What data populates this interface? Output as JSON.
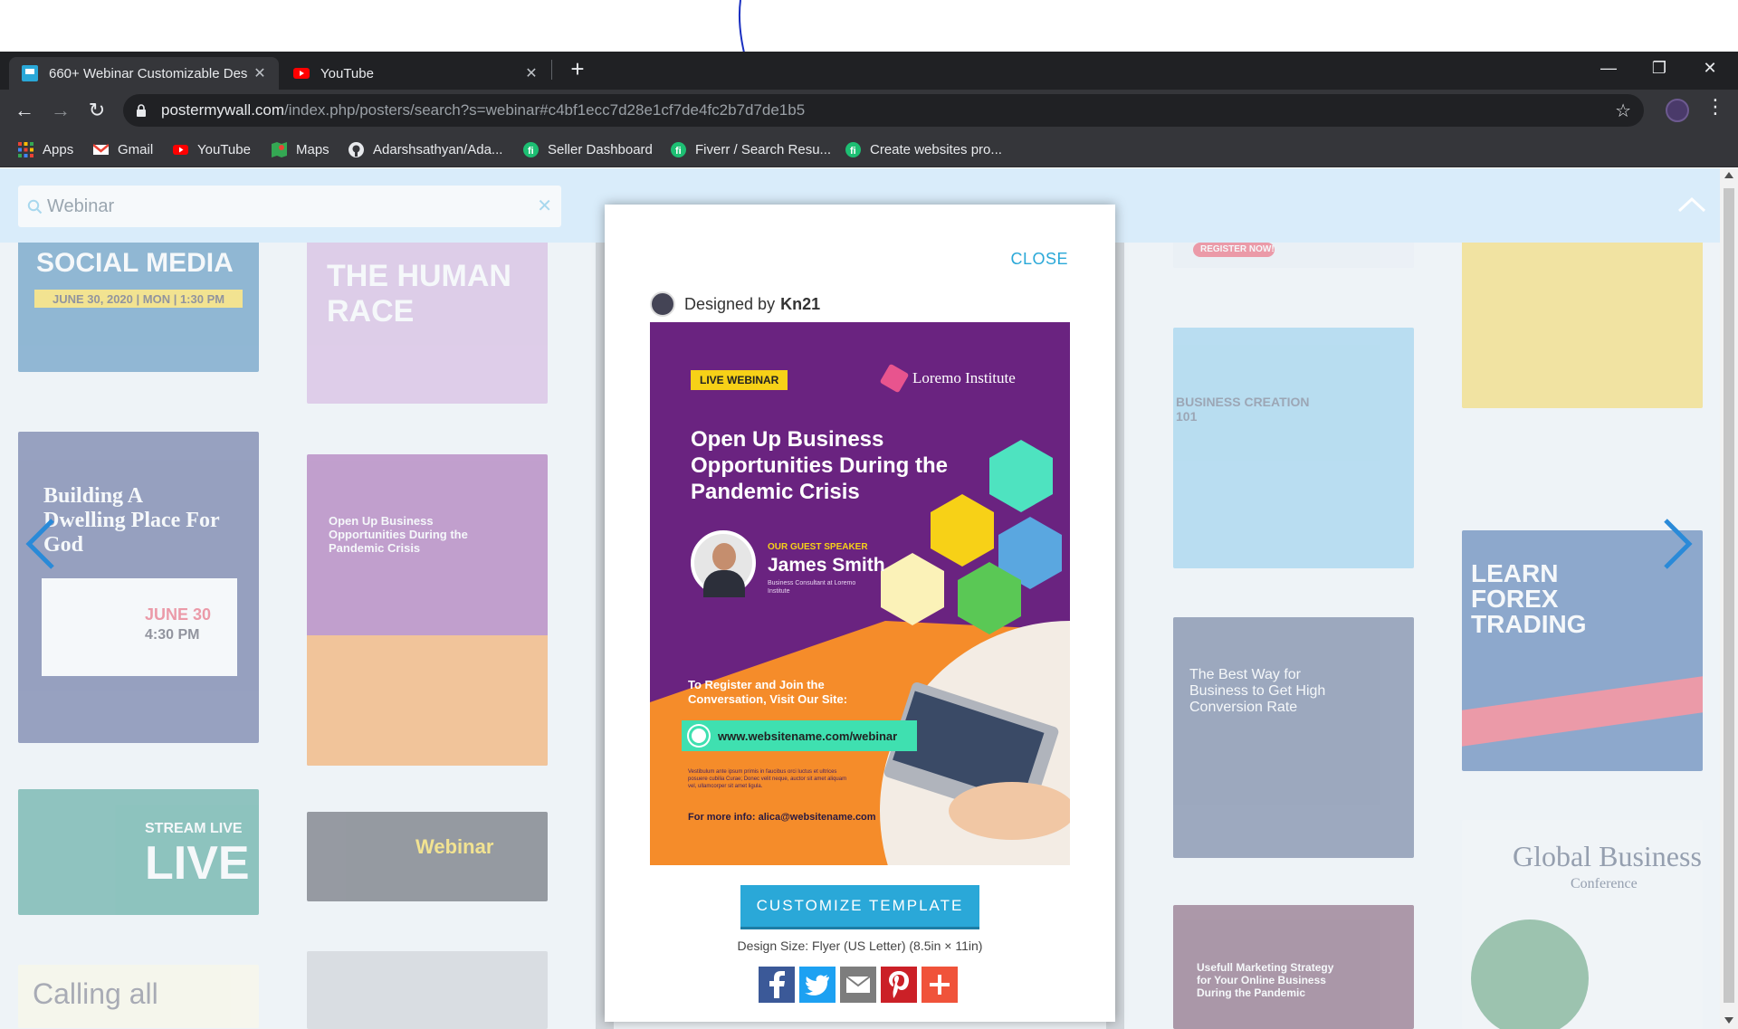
{
  "browser": {
    "tabs": [
      {
        "title": "660+ Webinar Customizable Des",
        "active": true
      },
      {
        "title": "YouTube",
        "active": false
      }
    ],
    "address": {
      "host": "postermywall.com",
      "path": "/index.php/posters/search?s=webinar#c4bf1ecc7d28e1cf7de4fc2b7d7de1b5"
    },
    "bookmarks": [
      "Apps",
      "Gmail",
      "YouTube",
      "Maps",
      "Adarshsathyan/Ada...",
      "Seller Dashboard",
      "Fiverr / Search Resu...",
      "Create websites pro..."
    ]
  },
  "search": {
    "value": "Webinar"
  },
  "background_cards": {
    "c1": "SOCIAL MEDIA",
    "c1b": "JUNE 30, 2020 | MON | 1:30 PM",
    "c2": "THE HUMAN RACE",
    "c3": "Building A Dwelling Place For God",
    "c3b": "JUNE 30",
    "c3c": "4:30 PM",
    "c4": "Open Up Business Opportunities During the Pandemic Crisis",
    "c5": "STREAM LIVE",
    "c5b": "LIVE",
    "c6": "Webinar",
    "c7": "Calling all",
    "c8": "REGISTER NOW!",
    "c9": "BUSINESS CREATION 101",
    "c10": "The Best Way for Business to Get High Conversion Rate",
    "c11": "Usefull Marketing Strategy for Your Online Business During the Pandemic",
    "c12": "LEARN FOREX TRADING",
    "c13": "Global Business",
    "c13b": "Conference"
  },
  "modal": {
    "close_label": "CLOSE",
    "designed_by_label": "Designed by",
    "designer_name": "Kn21",
    "poster": {
      "badge": "LIVE WEBINAR",
      "institute": "Loremo Institute",
      "headline": "Open Up Business Opportunities During the Pandemic Crisis",
      "guest_label": "OUR GUEST SPEAKER",
      "guest_name": "James Smith",
      "guest_role": "Business Consultant at Loremo Institute",
      "register_text": "To Register and  Join the Conversation, Visit Our Site:",
      "url": "www.websitename.com/webinar",
      "lorem": "Vestibulum ante ipsum primis in faucibus orci luctus et ultrices posuere cubilia Curae; Donec velit neque, auctor sit amet aliquam vel, ullamcorper sit amet ligula.",
      "more_info": "For more info: alica@websitename.com"
    },
    "customize_label": "CUSTOMIZE TEMPLATE",
    "design_size": "Design Size: Flyer (US Letter) (8.5in × 11in)",
    "share_buttons": [
      {
        "name": "facebook",
        "color": "#3b5998"
      },
      {
        "name": "twitter",
        "color": "#1da1f2"
      },
      {
        "name": "email",
        "color": "#7d7d7d"
      },
      {
        "name": "pinterest",
        "color": "#cb2027"
      },
      {
        "name": "more",
        "color": "#f0533a"
      }
    ]
  }
}
